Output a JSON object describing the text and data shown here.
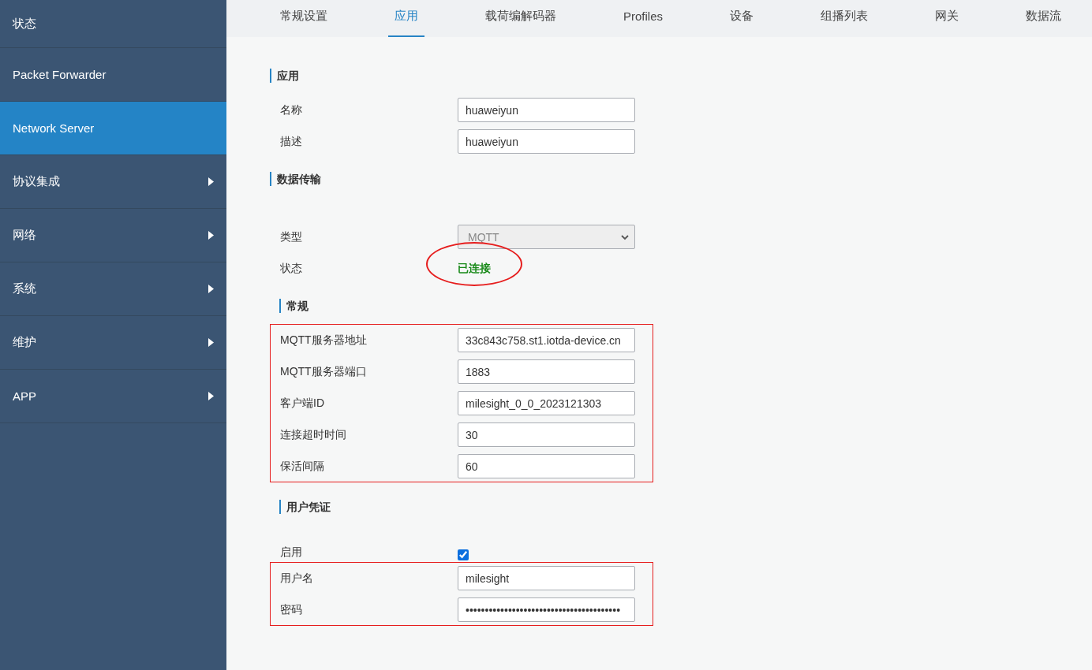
{
  "sidebar": {
    "items": [
      {
        "label": "状态",
        "selected": false,
        "expandable": false
      },
      {
        "label": "Packet Forwarder",
        "selected": false,
        "expandable": false
      },
      {
        "label": "Network Server",
        "selected": true,
        "expandable": false
      },
      {
        "label": "协议集成",
        "selected": false,
        "expandable": true
      },
      {
        "label": "网络",
        "selected": false,
        "expandable": true
      },
      {
        "label": "系统",
        "selected": false,
        "expandable": true
      },
      {
        "label": "维护",
        "selected": false,
        "expandable": true
      },
      {
        "label": "APP",
        "selected": false,
        "expandable": true
      }
    ]
  },
  "tabs": [
    {
      "label": "常规设置",
      "selected": false
    },
    {
      "label": "应用",
      "selected": true
    },
    {
      "label": "载荷编解码器",
      "selected": false
    },
    {
      "label": "Profiles",
      "selected": false
    },
    {
      "label": "设备",
      "selected": false
    },
    {
      "label": "组播列表",
      "selected": false
    },
    {
      "label": "网关",
      "selected": false
    },
    {
      "label": "数据流",
      "selected": false
    }
  ],
  "form": [
    {
      "kind": "heading",
      "title": "应用",
      "indented": false
    },
    {
      "kind": "group",
      "highlighted": false,
      "rows": [
        {
          "kind": "input",
          "label": "名称",
          "value": "huaweiyun"
        },
        {
          "kind": "input",
          "label": "描述",
          "value": "huaweiyun"
        }
      ]
    },
    {
      "kind": "heading",
      "title": "数据传输",
      "indented": false
    },
    {
      "kind": "group",
      "highlighted": false,
      "rows": [
        {
          "kind": "select",
          "label": "类型",
          "value": "MQTT",
          "disabled": true
        },
        {
          "kind": "status",
          "label": "状态",
          "value": "已连接",
          "circled": true
        }
      ]
    },
    {
      "kind": "heading",
      "title": "常规",
      "indented": true
    },
    {
      "kind": "group",
      "highlighted": true,
      "rows": [
        {
          "kind": "input",
          "label": "MQTT服务器地址",
          "value": "33c843c758.st1.iotda-device.cn"
        },
        {
          "kind": "input",
          "label": "MQTT服务器端口",
          "value": "1883"
        },
        {
          "kind": "input",
          "label": "客户端ID",
          "value": "milesight_0_0_2023121303"
        },
        {
          "kind": "input",
          "label": "连接超时时间",
          "value": "30"
        },
        {
          "kind": "input",
          "label": "保活间隔",
          "value": "60"
        }
      ]
    },
    {
      "kind": "heading",
      "title": "用户凭证",
      "indented": true
    },
    {
      "kind": "group",
      "highlighted": false,
      "rows": [
        {
          "kind": "checkbox",
          "label": "启用",
          "checked": true
        }
      ]
    },
    {
      "kind": "group",
      "highlighted": true,
      "rows": [
        {
          "kind": "input",
          "label": "用户名",
          "value": "milesight"
        },
        {
          "kind": "input",
          "label": "密码",
          "value": "••••••••••••••••••••••••••••••••••••••••"
        }
      ]
    }
  ]
}
